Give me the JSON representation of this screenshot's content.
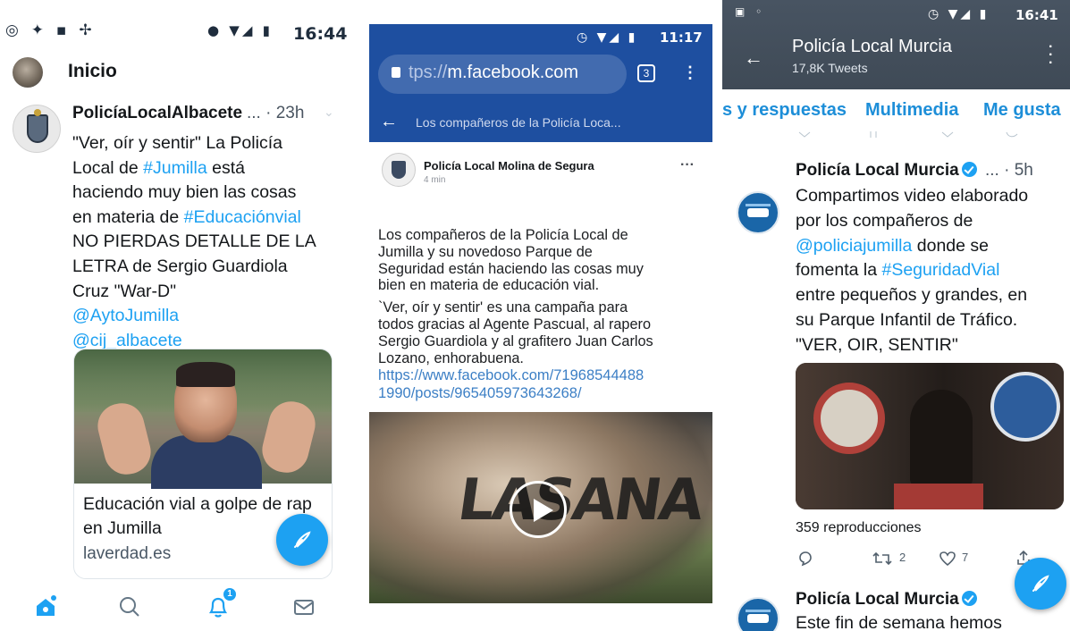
{
  "panel1": {
    "status_time": "16:44",
    "header_title": "Inicio",
    "tweet": {
      "author": "PolicíaLocalAlbacete",
      "meta": "... · 23h",
      "lines": [
        {
          "text": "\"Ver, oír y sentir\" La Policía"
        },
        {
          "pre": "Local de ",
          "link": "#Jumilla",
          "post": " está"
        },
        {
          "text": "haciendo muy bien las cosas"
        },
        {
          "pre": "en materia de ",
          "link": "#Educaciónvial",
          "post": ""
        },
        {
          "text": "NO PIERDAS DETALLE DE LA"
        },
        {
          "text": "LETRA de Sergio Guardiola"
        },
        {
          "text": "Cruz \"War-D\""
        },
        {
          "link": "@AytoJumilla"
        },
        {
          "link": "@cij_albacete"
        }
      ],
      "card_title": "Educación vial a golpe de rap en Jumilla",
      "card_source": "laverdad.es"
    },
    "nav_badge": "1"
  },
  "panel2": {
    "status_time": "11:17",
    "url_dim": "tps://",
    "url_main": "m.facebook.com",
    "tab_count": "3",
    "page_title": "Los compañeros de la Policía Loca...",
    "post": {
      "author": "Policía Local Molina de Segura",
      "time": "4 min",
      "lines1": [
        "Los compañeros de la Policía Local de",
        "Jumilla y su novedoso Parque de",
        "Seguridad están haciendo las cosas muy",
        "bien en materia de educación vial."
      ],
      "lines2": [
        "`Ver, oír y sentir' es una campaña para",
        "todos gracias al Agente Pascual, al rapero",
        "Sergio Guardiola y al grafitero Juan Carlos",
        "Lozano, enhorabuena."
      ],
      "link_lines": [
        "https://www.facebook.com/71968544488",
        "1990/posts/965405973643268/"
      ],
      "video_overlay_text": "LASANA"
    }
  },
  "panel3": {
    "status_time": "16:41",
    "profile_title": "Policía Local Murcia",
    "tweet_count": "17,8K Tweets",
    "tabs": [
      "s y respuestas",
      "Multimedia",
      "Me gusta"
    ],
    "tweet": {
      "author": "Policía Local Murcia",
      "meta": "... · 5h",
      "lines": [
        {
          "text": "Compartimos video elaborado"
        },
        {
          "text": "por los compañeros de"
        },
        {
          "pre": "",
          "link": "@policiajumilla",
          "post": "  donde se"
        },
        {
          "pre": "fomenta la ",
          "link": "#SeguridadVial",
          "post": ""
        },
        {
          "text": "entre pequeños y grandes, en"
        },
        {
          "text": "su  Parque Infantil de Tráfico."
        },
        {
          "text": "\"VER, OIR, SENTIR\""
        }
      ],
      "views": "359 reproducciones",
      "retweets": "2",
      "likes": "7"
    },
    "next_tweet": {
      "author": "Policía Local Murcia",
      "text": "Este fin de semana hemos"
    }
  }
}
